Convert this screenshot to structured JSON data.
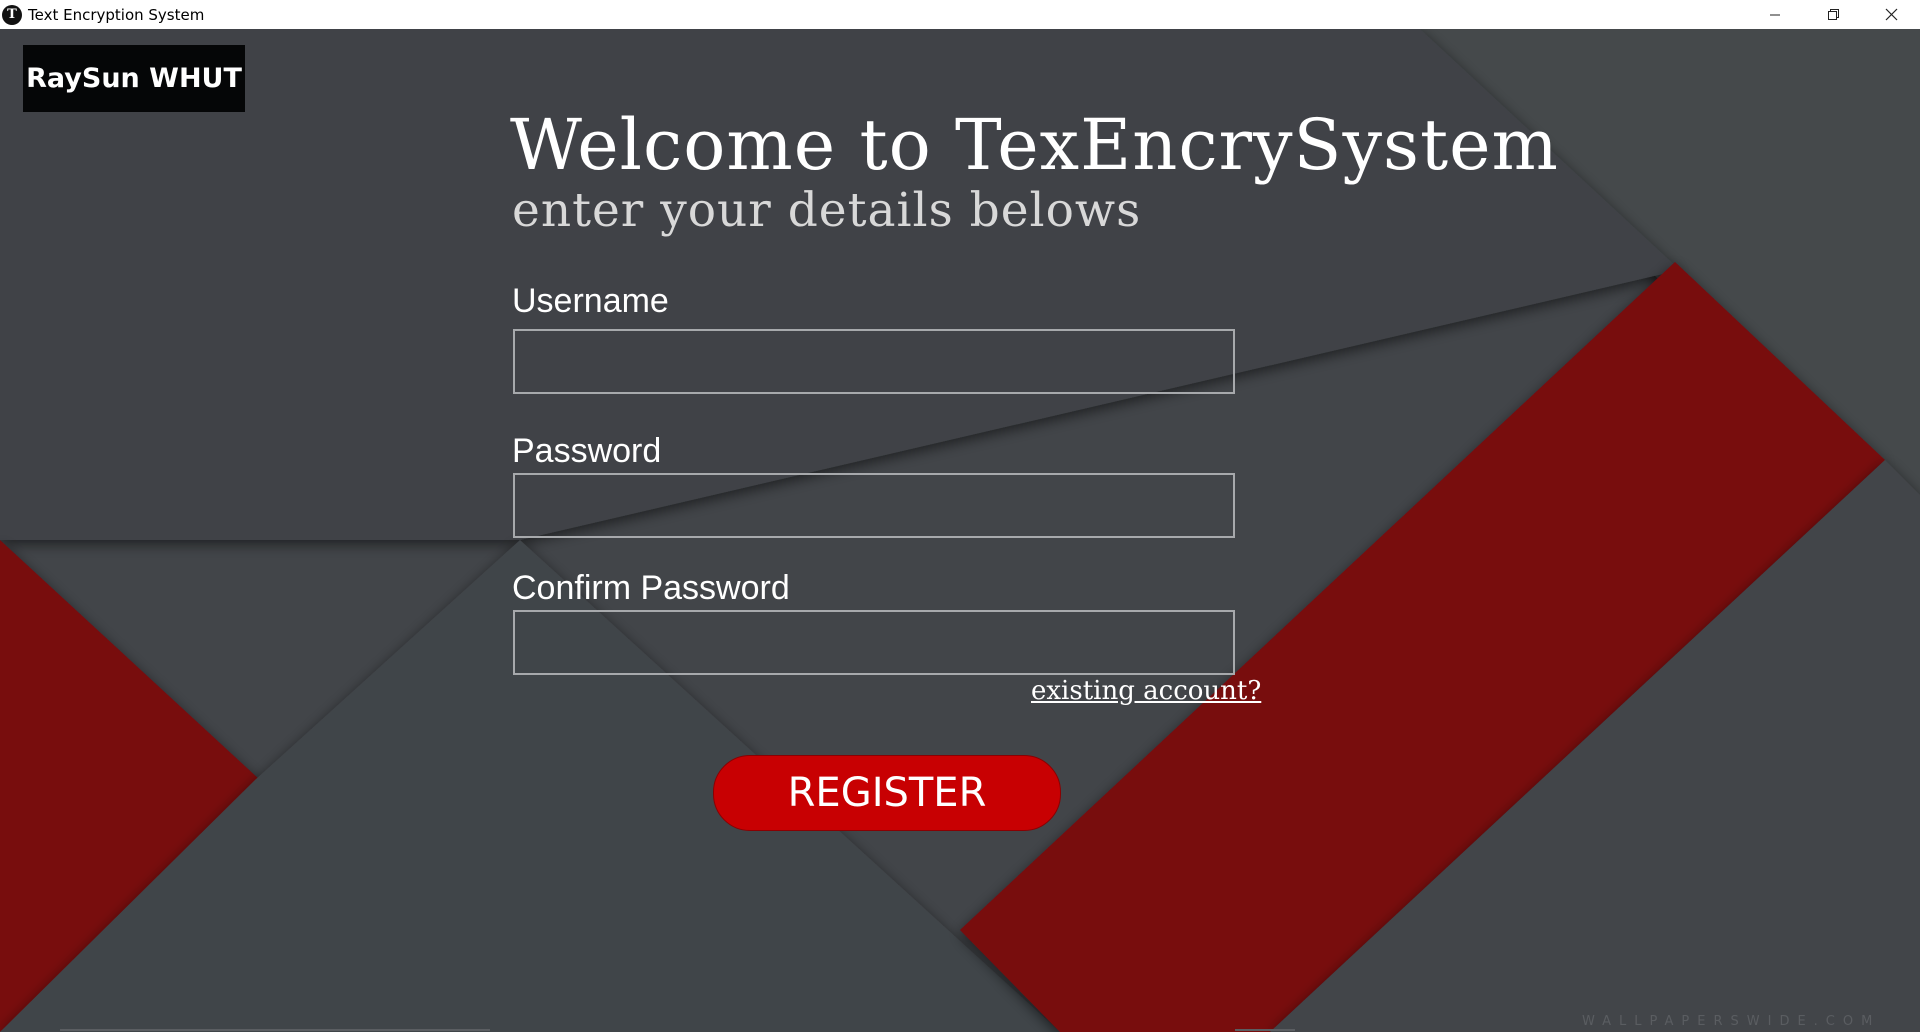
{
  "window": {
    "title": "Text Encryption System",
    "icon": "app-logo-icon",
    "controls": [
      "minimize-icon",
      "restore-icon",
      "close-icon"
    ]
  },
  "brand": {
    "label": "RaySun WHUT"
  },
  "header": {
    "title": "Welcome to TexEncrySystem",
    "subtitle": "enter your details belows"
  },
  "form": {
    "username_label": "Username",
    "username_value": "",
    "password_label": "Password",
    "password_value": "",
    "confirm_label": "Confirm Password",
    "confirm_value": "",
    "existing_account_link": "existing account?",
    "register_label": "REGISTER"
  },
  "colors": {
    "background": "#424549",
    "accent_red": "#c80002",
    "stripe_red": "#7a0810",
    "brand_bg": "#050607"
  },
  "watermark": "WALLPAPERSWIDE.COM"
}
